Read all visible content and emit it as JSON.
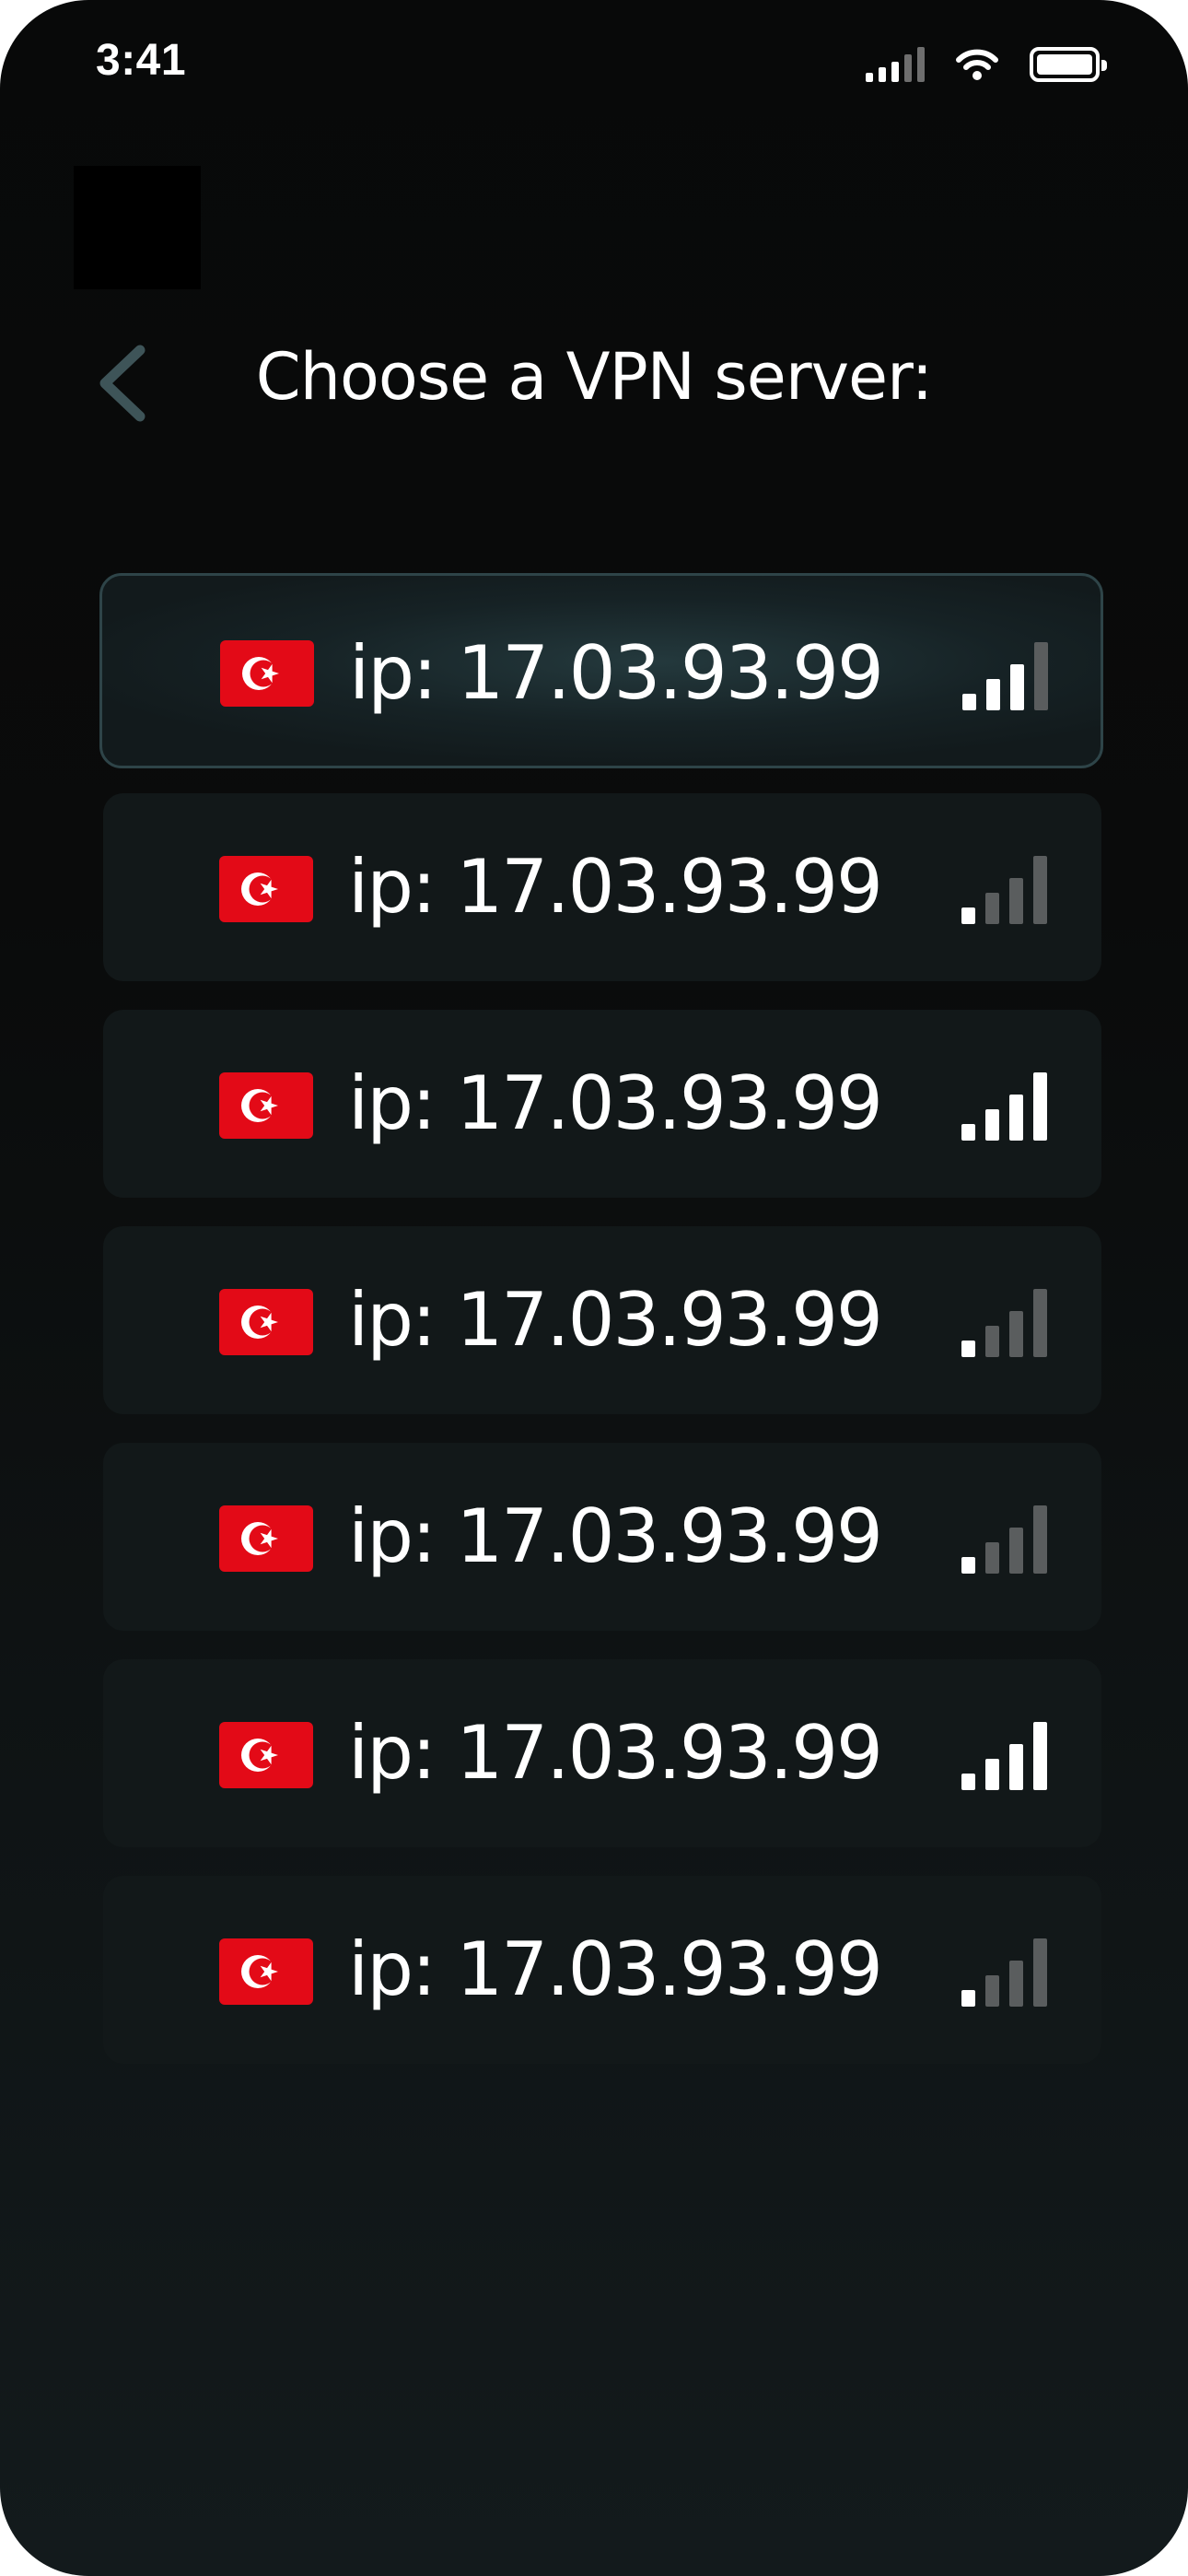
{
  "status_bar": {
    "time": "3:41",
    "icons": [
      "cellular-signal-icon",
      "wifi-icon",
      "battery-icon"
    ]
  },
  "header": {
    "back_icon": "chevron-left-icon",
    "title": "Choose a VPN server:"
  },
  "colors": {
    "background_top": "#080909",
    "background_bottom": "#131a1c",
    "row_background": "#121819",
    "selected_border": "#2e4448",
    "flag_red": "#e30a17",
    "back_icon": "#3e5458",
    "signal_on": "#ffffff",
    "signal_off": "#5a5d5e"
  },
  "servers": [
    {
      "flag": "turkey-flag-icon",
      "label": "ip: 17.03.93.99",
      "signal_bars": 3,
      "selected": true
    },
    {
      "flag": "turkey-flag-icon",
      "label": "ip: 17.03.93.99",
      "signal_bars": 1,
      "selected": false
    },
    {
      "flag": "turkey-flag-icon",
      "label": "ip: 17.03.93.99",
      "signal_bars": 4,
      "selected": false
    },
    {
      "flag": "turkey-flag-icon",
      "label": "ip: 17.03.93.99",
      "signal_bars": 1,
      "selected": false
    },
    {
      "flag": "turkey-flag-icon",
      "label": "ip: 17.03.93.99",
      "signal_bars": 1,
      "selected": false
    },
    {
      "flag": "turkey-flag-icon",
      "label": "ip: 17.03.93.99",
      "signal_bars": 4,
      "selected": false
    },
    {
      "flag": "turkey-flag-icon",
      "label": "ip: 17.03.93.99",
      "signal_bars": 1,
      "selected": false
    }
  ]
}
